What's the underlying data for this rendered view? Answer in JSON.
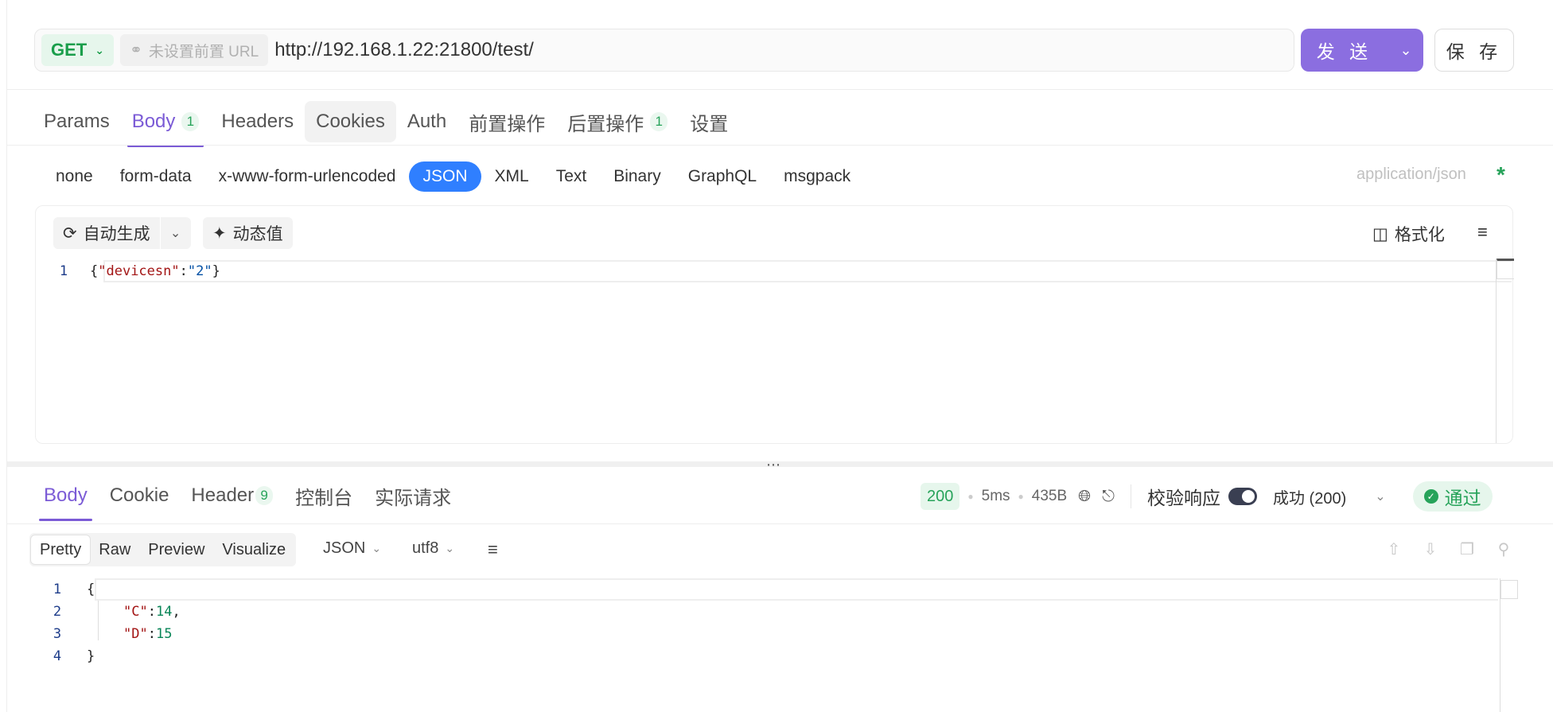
{
  "request": {
    "method": "GET",
    "prefix_url": "未设置前置 URL",
    "url": "http://192.168.1.22:21800/test/",
    "send_label": "发 送",
    "save_label": "保 存"
  },
  "request_tabs": [
    {
      "label": "Params",
      "badge": ""
    },
    {
      "label": "Body",
      "badge": "1"
    },
    {
      "label": "Headers",
      "badge": ""
    },
    {
      "label": "Cookies",
      "badge": ""
    },
    {
      "label": "Auth",
      "badge": ""
    },
    {
      "label": "前置操作",
      "badge": ""
    },
    {
      "label": "后置操作",
      "badge": "1"
    },
    {
      "label": "设置",
      "badge": ""
    }
  ],
  "body_types": [
    "none",
    "form-data",
    "x-www-form-urlencoded",
    "JSON",
    "XML",
    "Text",
    "Binary",
    "GraphQL",
    "msgpack"
  ],
  "body_type_active": "JSON",
  "content_type": "application/json",
  "content_required_mark": "*",
  "editor_toolbar": {
    "auto_generate": "自动生成",
    "dynamic_value": "动态值",
    "format": "格式化"
  },
  "request_body": {
    "line_number": "1",
    "open_brace": "{",
    "key": "\"devicesn\"",
    "colon": ":",
    "value": "\"2\"",
    "close_brace": "}"
  },
  "response_tabs": [
    {
      "label": "Body",
      "badge": ""
    },
    {
      "label": "Cookie",
      "badge": ""
    },
    {
      "label": "Header",
      "badge": "9"
    },
    {
      "label": "控制台",
      "badge": ""
    },
    {
      "label": "实际请求",
      "badge": ""
    }
  ],
  "response_meta": {
    "status": "200",
    "time": "5ms",
    "size": "435B",
    "verify_label": "校验响应",
    "result": "成功 (200)",
    "pass_label": "通过"
  },
  "view_modes": [
    "Pretty",
    "Raw",
    "Preview",
    "Visualize"
  ],
  "view_mode_active": "Pretty",
  "response_format": "JSON",
  "response_encoding": "utf8",
  "response_lines": {
    "l1": {
      "num": "1",
      "text": "{"
    },
    "l2": {
      "num": "2",
      "key": "\"C\"",
      "sep": ": ",
      "value": "14",
      "tail": ","
    },
    "l3": {
      "num": "3",
      "key": "\"D\"",
      "sep": ": ",
      "value": "15"
    },
    "l4": {
      "num": "4",
      "text": "}"
    }
  },
  "icons": {
    "method_chevron": "chevron-down-icon",
    "link": "link-icon",
    "refresh": "refresh-icon",
    "magic_wand": "magic-wand-icon",
    "format": "format-icon",
    "wrap": "wrap-lines-icon",
    "globe": "globe-icon",
    "share": "share-icon",
    "check": "check-circle-icon",
    "upload": "upload-icon",
    "download": "download-icon",
    "copy": "copy-icon",
    "search": "search-icon"
  },
  "colors": {
    "accent": "#8b6ee0",
    "active_tab": "#7b5bd6",
    "json_pill": "#2f7fff",
    "success": "#27a35a",
    "success_bg": "#e6f6ec"
  }
}
